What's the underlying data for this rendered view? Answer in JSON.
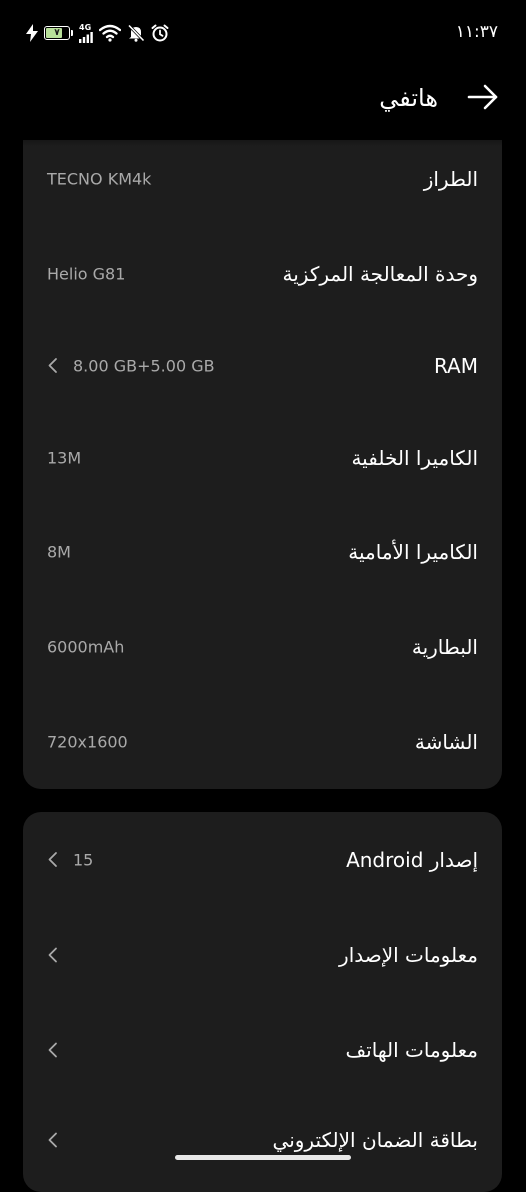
{
  "status_bar": {
    "time": "١١:٣٧",
    "battery_text": "٧",
    "network": "4G",
    "icons": [
      "charging-bolt-icon",
      "battery-icon",
      "signal-icon",
      "wifi-icon",
      "silent-bell-icon",
      "alarm-icon"
    ]
  },
  "header": {
    "title": "هاتفي",
    "back_icon": "arrow-right-icon"
  },
  "specs": [
    {
      "label": "الطراز",
      "value": "TECNO KM4k",
      "chevron": false
    },
    {
      "label": "وحدة المعالجة المركزية",
      "value": "Helio G81",
      "chevron": false
    },
    {
      "label": "RAM",
      "value": "8.00 GB+5.00 GB",
      "chevron": true
    },
    {
      "label": "الكاميرا الخلفية",
      "value": "13M",
      "chevron": false
    },
    {
      "label": "الكاميرا الأمامية",
      "value": "8M",
      "chevron": false
    },
    {
      "label": "البطارية",
      "value": "6000mAh",
      "chevron": false
    },
    {
      "label": "الشاشة",
      "value": "720x1600",
      "chevron": false
    }
  ],
  "info": [
    {
      "label": "إصدار Android",
      "value": "15",
      "chevron": true
    },
    {
      "label": "معلومات الإصدار",
      "value": "",
      "chevron": true
    },
    {
      "label": "معلومات الهاتف",
      "value": "",
      "chevron": true
    },
    {
      "label": "بطاقة الضمان الإلكتروني",
      "value": "",
      "chevron": true
    }
  ],
  "colors": {
    "background": "#000000",
    "card": "#1d1d1d",
    "label": "#ffffff",
    "value": "#a9a9a9",
    "battery_fill": "#b8e09a"
  }
}
